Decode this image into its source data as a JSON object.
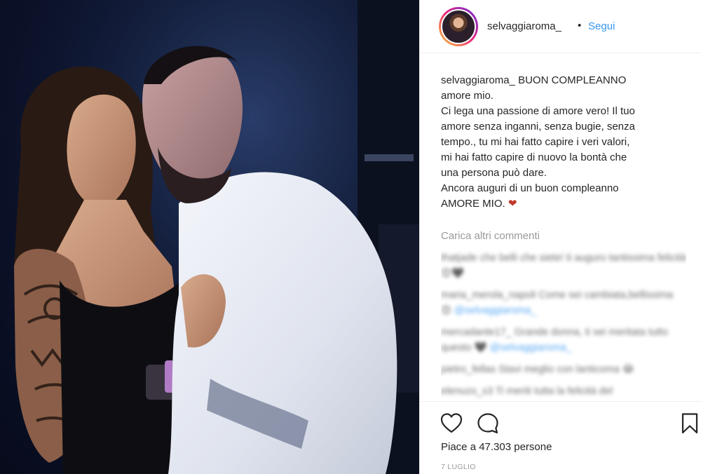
{
  "post": {
    "username": "selvaggiaroma_",
    "separator": "•",
    "follow_label": "Segui"
  },
  "caption": {
    "username": "selvaggiaroma_",
    "text": " BUON COMPLEANNO\namore mio.\nCi lega una passione di amore vero! Il tuo\namore senza inganni, senza bugie, senza\ntempo., tu mi hai fatto capire i veri valori,\nmi hai fatto capire di nuovo la bontà che\nuna persona può dare.\nAncora auguri di un buon compleanno\nAMORE MIO. ",
    "heart": "❤"
  },
  "load_more_label": "Carica altri commenti",
  "comments": [
    {
      "text": "thatjade che belli che siete! ti auguro tantissima felicità",
      "emoji": "😍🖤",
      "mention": ""
    },
    {
      "text": "maria_merola_napoli Come sei cambiata,bellissima",
      "emoji": "😍",
      "mention": "@selvaggiaroma_"
    },
    {
      "text": "mercadante17_ Grande donna, ti sei meritata tutto questo",
      "emoji": "🖤",
      "mention": "@selvaggiaroma_"
    },
    {
      "text": "pietro_fellas Stavi meglio con lanticoma",
      "emoji": "😂",
      "mention": ""
    },
    {
      "text": "elenuzo_s3 Ti meriti tutta la felicità del",
      "emoji": "",
      "mention": ""
    }
  ],
  "actions": {
    "like_icon": "heart-outline-icon",
    "comment_icon": "comment-bubble-icon",
    "save_icon": "bookmark-icon"
  },
  "likes_text": "Piace a 47.303 persone",
  "date_text": "7 LUGLIO",
  "colors": {
    "link": "#3897f0",
    "muted": "#999999",
    "heart": "#ed4956",
    "text": "#262626"
  }
}
